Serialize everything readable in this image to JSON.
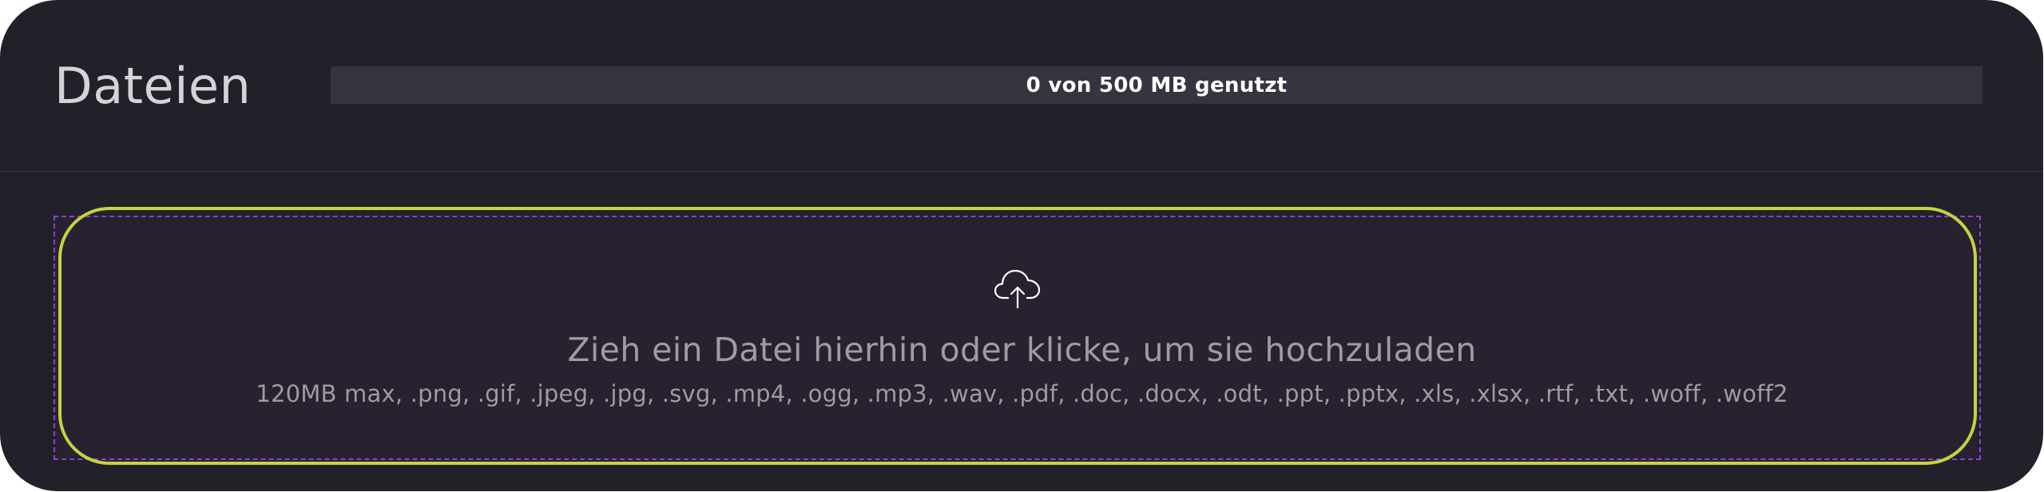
{
  "header": {
    "title": "Dateien"
  },
  "storage": {
    "used_mb": 0,
    "total_mb": 500,
    "usage_label": "0 von 500 MB genutzt"
  },
  "upload": {
    "icon": "cloud-upload-icon",
    "prompt": "Zieh ein Datei hierhin oder klicke, um sie hochzuladen",
    "hint": "120MB max, .png, .gif, .jpeg, .jpg, .svg, .mp4, .ogg, .mp3, .wav, .pdf, .doc, .docx, .odt, .ppt, .pptx, .xls, .xlsx, .rtf, .txt, .woff, .woff2"
  },
  "colors": {
    "panel_background": "#22212a",
    "bar_background": "#35343f",
    "dropzone_background": "#28212f",
    "dropzone_border": "#8b3fd4",
    "focus_ring": "#c3d33e",
    "muted_text": "#9e9ba5"
  }
}
